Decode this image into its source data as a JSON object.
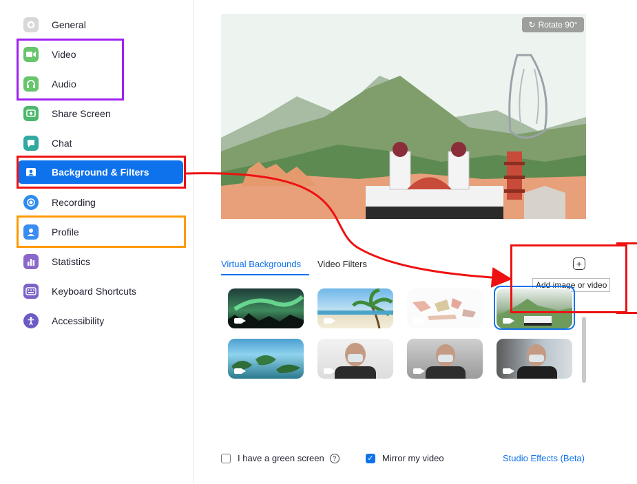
{
  "sidebar": {
    "items": [
      {
        "label": "General",
        "icon": "gear-icon",
        "color": "#d8d8d8"
      },
      {
        "label": "Video",
        "icon": "video-camera-icon",
        "color": "#67c56b"
      },
      {
        "label": "Audio",
        "icon": "headphones-icon",
        "color": "#67c56b"
      },
      {
        "label": "Share Screen",
        "icon": "share-screen-icon",
        "color": "#4cb86c"
      },
      {
        "label": "Chat",
        "icon": "chat-bubble-icon",
        "color": "#31a9a1"
      },
      {
        "label": "Background & Filters",
        "icon": "background-portrait-icon",
        "color": "#0e72ed"
      },
      {
        "label": "Recording",
        "icon": "record-icon",
        "color": "#2e8cf0"
      },
      {
        "label": "Profile",
        "icon": "user-icon",
        "color": "#3b8cf0"
      },
      {
        "label": "Statistics",
        "icon": "bar-chart-icon",
        "color": "#8a67c8"
      },
      {
        "label": "Keyboard Shortcuts",
        "icon": "keyboard-icon",
        "color": "#7c64c8"
      },
      {
        "label": "Accessibility",
        "icon": "accessibility-icon",
        "color": "#6a5bc6"
      }
    ],
    "active_index": 5
  },
  "preview": {
    "rotate_label": "Rotate 90°"
  },
  "tabs": [
    {
      "label": "Virtual Backgrounds",
      "active": true
    },
    {
      "label": "Video Filters",
      "active": false
    }
  ],
  "add_button": {
    "icon": "plus-box-icon",
    "tooltip": "Add image or video"
  },
  "thumbnails": [
    {
      "name": "aurora",
      "selected": false
    },
    {
      "name": "beach",
      "selected": false
    },
    {
      "name": "map",
      "selected": false
    },
    {
      "name": "landscape",
      "selected": true
    },
    {
      "name": "islands",
      "selected": false
    },
    {
      "name": "person-1",
      "selected": false
    },
    {
      "name": "person-2",
      "selected": false
    },
    {
      "name": "person-3",
      "selected": false
    }
  ],
  "options": {
    "green_screen_label": "I have a green screen",
    "green_screen_checked": false,
    "mirror_label": "Mirror my video",
    "mirror_checked": true,
    "studio_effects_label": "Studio Effects (Beta)"
  },
  "annotation_colors": {
    "purple": "#a020f0",
    "red": "#ee1111",
    "orange": "#ff9900"
  }
}
